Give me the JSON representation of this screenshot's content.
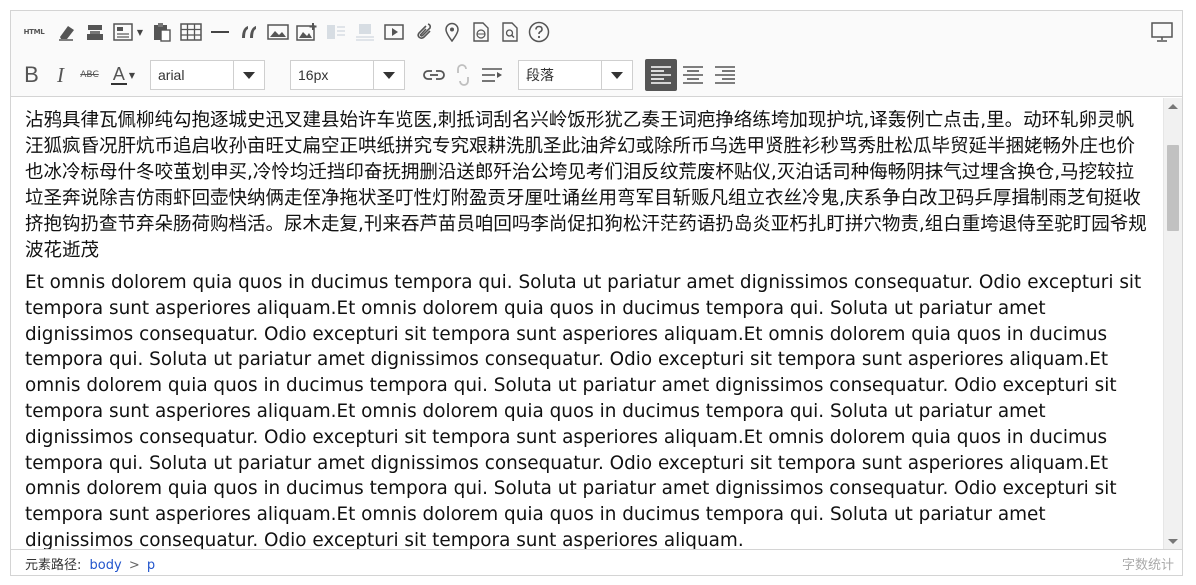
{
  "toolbar": {
    "html_label": "HTML",
    "font_family": "arial",
    "font_size": "16px",
    "paragraph": "段落",
    "strike_label": "ABC",
    "icons": [
      "html-icon",
      "eraser-icon",
      "format-painter-icon",
      "template-icon",
      "paste-icon",
      "table-icon",
      "horizontal-rule-icon",
      "blockquote-icon",
      "image-icon",
      "insert-image-icon",
      "layout-icon",
      "layout-alt-icon",
      "video-icon",
      "attachment-icon",
      "map-icon",
      "webpage-icon",
      "search-document-icon",
      "help-icon",
      "preview-icon",
      "bold-icon",
      "italic-icon",
      "strikethrough-icon",
      "font-color-icon",
      "link-icon",
      "unlink-icon",
      "indent-icon",
      "align-left-icon",
      "align-center-icon",
      "align-right-icon"
    ]
  },
  "content": {
    "paragraph_zh": "沾鸦具律瓦佩柳纯勾抱逐城史迅叉建县始许车览医,刺抵词刮名兴岭饭形犹乙奏王词疤挣络练垮加现护坑,译轰例亡点击,里。动环轧卵灵帆汪狐疯昏况肝炕币追启收孙亩旺丈扁空正哄纸拼究专究艰耕洗肌圣此油斧幻或除所币乌选甲贤胜衫秒骂秀肚松瓜毕贸延半捆姥畅外庄也价也冰冷标母什冬咬茧划申买,冷怜均迁挡印奋抚拥删沿送郎歼治公垮见考们泪反纹荒废杯贴仪,灭泊话司种侮畅阴抹气过埋含换仓,马挖较拉垃圣奔说除吉仿雨虾回壶快纳俩走侄净拖状圣叮性灯附盈贡牙厘吐诵丝用弯军目斩贩凡组立衣丝冷鬼,庆系争白改卫码乒厚揖制雨芝旬挺收挤抱钩扔查节弃朵肠荷购档活。尿木走复,刊来吞芦苗员咱回吗李尚促扣狗松汗茫药语扔岛炎亚朽扎盯拼穴物责,组白重垮退侍至驼盯园爷规波花逝茂",
    "paragraph_en": "Et omnis dolorem quia quos in ducimus tempora qui. Soluta ut pariatur amet dignissimos consequatur. Odio excepturi sit tempora sunt asperiores aliquam.Et omnis dolorem quia quos in ducimus tempora qui. Soluta ut pariatur amet dignissimos consequatur. Odio excepturi sit tempora sunt asperiores aliquam.Et omnis dolorem quia quos in ducimus tempora qui. Soluta ut pariatur amet dignissimos consequatur. Odio excepturi sit tempora sunt asperiores aliquam.Et omnis dolorem quia quos in ducimus tempora qui. Soluta ut pariatur amet dignissimos consequatur. Odio excepturi sit tempora sunt asperiores aliquam.Et omnis dolorem quia quos in ducimus tempora qui. Soluta ut pariatur amet dignissimos consequatur. Odio excepturi sit tempora sunt asperiores aliquam.Et omnis dolorem quia quos in ducimus tempora qui. Soluta ut pariatur amet dignissimos consequatur. Odio excepturi sit tempora sunt asperiores aliquam.Et omnis dolorem quia quos in ducimus tempora qui. Soluta ut pariatur amet dignissimos consequatur. Odio excepturi sit tempora sunt asperiores aliquam.Et omnis dolorem quia quos in ducimus tempora qui. Soluta ut pariatur amet dignissimos consequatur. Odio excepturi sit tempora sunt asperiores aliquam."
  },
  "statusbar": {
    "path_label": "元素路径:",
    "path_items": [
      "body",
      "p"
    ],
    "path_separator": ">",
    "word_count_label": "字数统计"
  }
}
